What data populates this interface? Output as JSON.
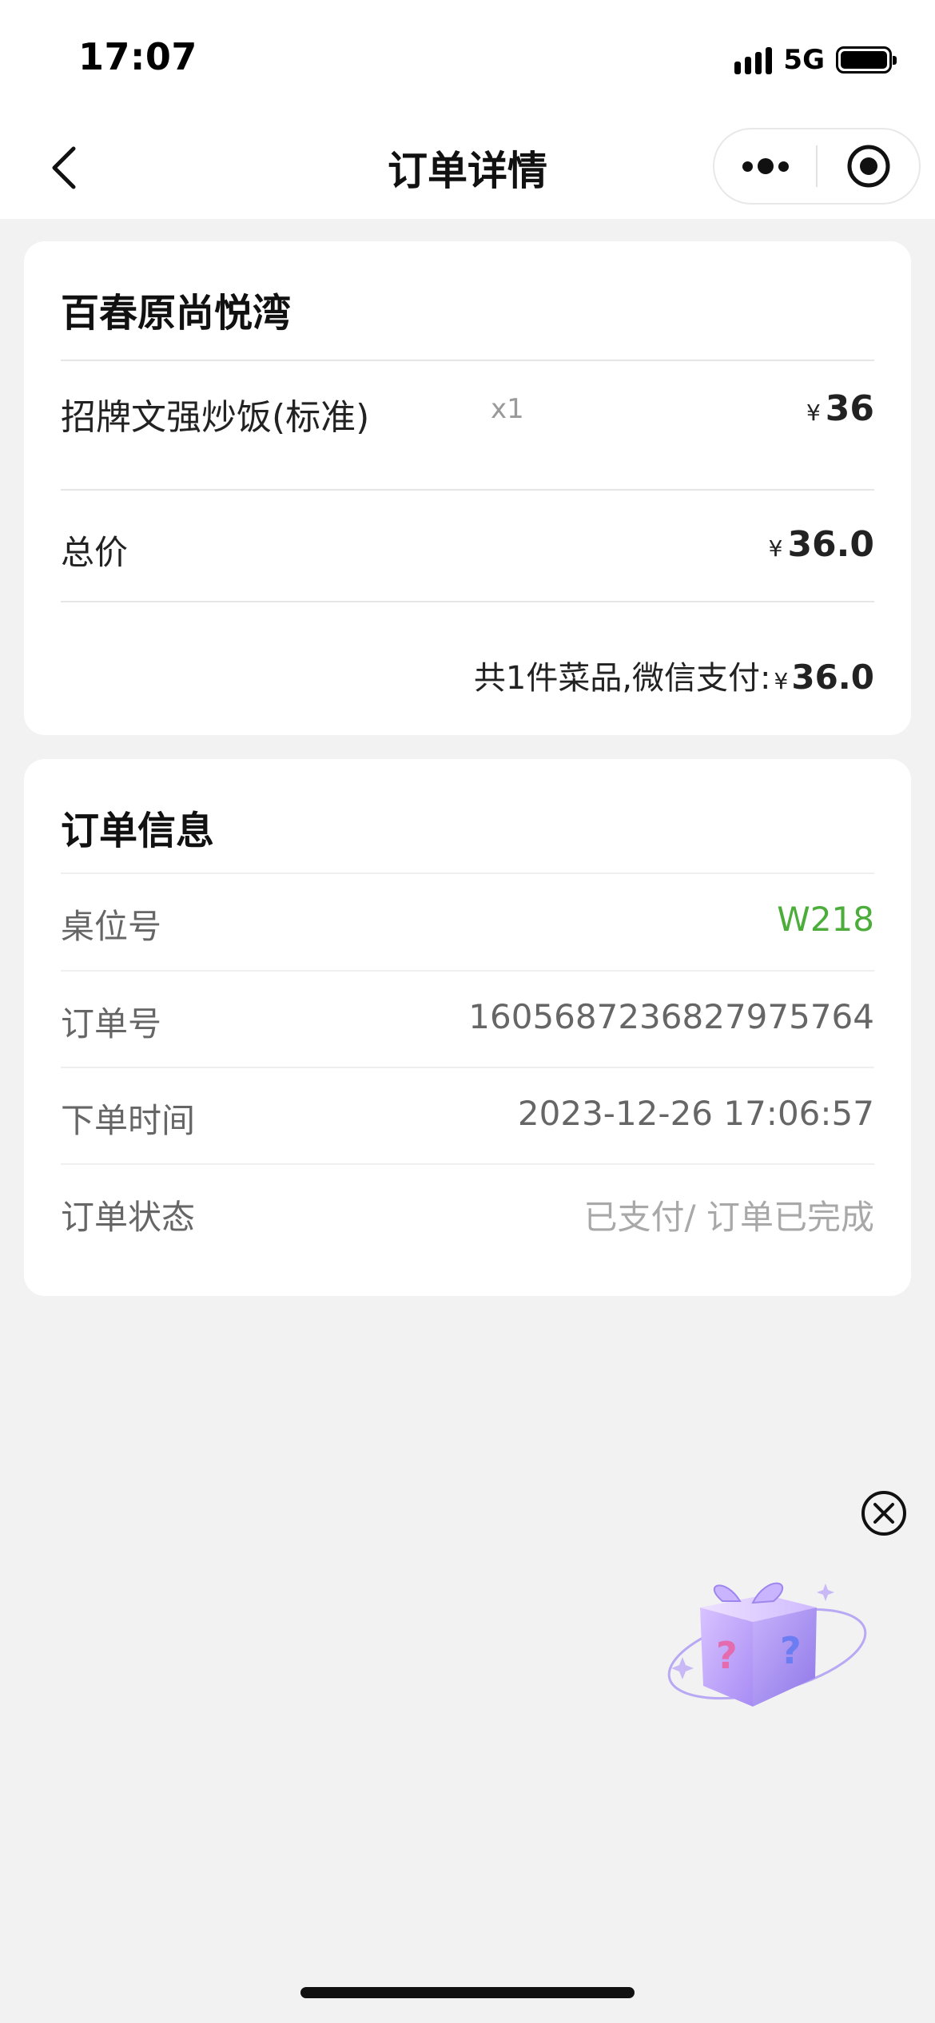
{
  "status_bar": {
    "time": "17:07",
    "network": "5G"
  },
  "nav": {
    "title": "订单详情",
    "back_icon": "chevron-left-icon",
    "more_icon": "more-dots-icon",
    "close_icon": "target-circle-icon"
  },
  "order_card": {
    "store_name": "百春原尚悦湾",
    "items": [
      {
        "name": "招牌文强炒饭(标准)",
        "qty": "x1",
        "currency": "¥",
        "price": "36"
      }
    ],
    "total_label": "总价",
    "total_currency": "¥",
    "total_price": "36.0",
    "summary_text": "共1件菜品,微信支付:",
    "summary_currency": "¥",
    "summary_amount": "36.0"
  },
  "info_card": {
    "title": "订单信息",
    "rows": [
      {
        "label": "桌位号",
        "value": "W218"
      },
      {
        "label": "订单号",
        "value": "1605687236827975764"
      },
      {
        "label": "下单时间",
        "value": "2023-12-26 17:06:57"
      },
      {
        "label": "订单状态",
        "value": "已支付/ 订单已完成"
      }
    ]
  },
  "floating": {
    "close_icon": "close-circle-icon",
    "gift_icon": "mystery-gift-box-icon"
  },
  "colors": {
    "accent_green": "#4cad3b",
    "background": "#f2f2f2"
  }
}
